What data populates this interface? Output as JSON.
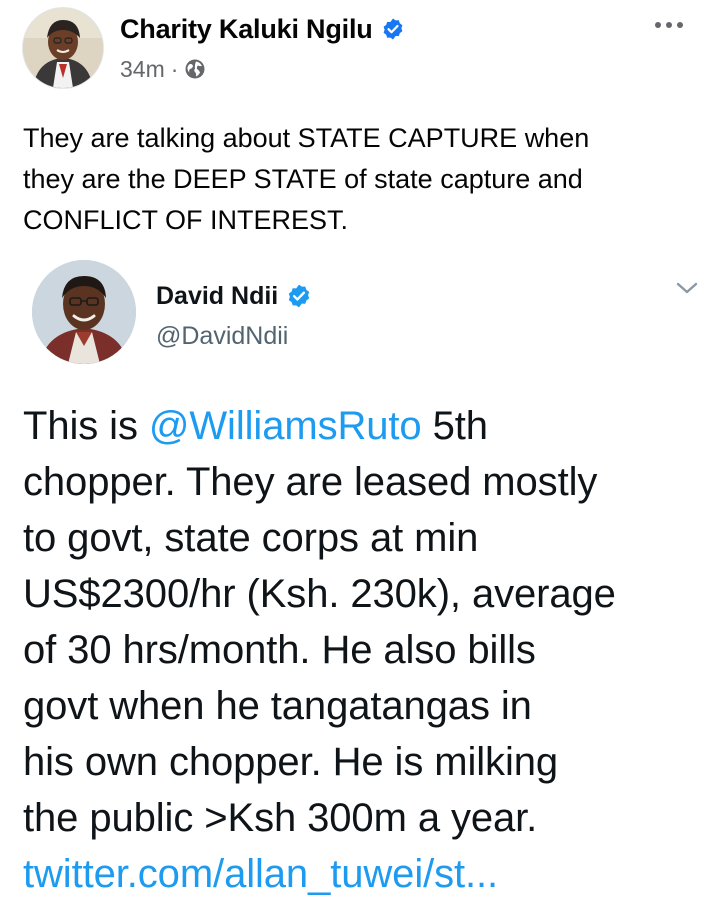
{
  "post": {
    "author": "Charity Kaluki Ngilu",
    "time": "34m",
    "separator": "·",
    "caption_lines": [
      "They are talking about STATE CAPTURE when",
      "they are the DEEP STATE of state capture and",
      "CONFLICT OF INTEREST."
    ],
    "icons": {
      "verified": "verified-badge-icon",
      "audience": "globe-icon",
      "more": "more-options-icon"
    }
  },
  "tweet": {
    "name": "David Ndii",
    "handle": "@DavidNdii",
    "line1_prefix": "This is ",
    "mention": "@WilliamsRuto",
    "line1_suffix": " 5th",
    "lines": [
      "chopper.  They are leased mostly",
      "to govt,  state corps at min",
      "US$2300/hr (Ksh. 230k), average",
      "of 30 hrs/month. He also bills",
      "govt when he tangatangas in",
      "his own chopper. He is milking",
      "the public >Ksh 300m a year."
    ],
    "link": "twitter.com/allan_tuwei/st...",
    "icons": {
      "verified": "verified-badge-icon",
      "menu": "chevron-down-icon"
    }
  },
  "colors": {
    "facebook_verified": "#1877f2",
    "twitter_blue": "#1d9bf0",
    "secondary_text": "#65676b",
    "handle_text": "#536471"
  }
}
